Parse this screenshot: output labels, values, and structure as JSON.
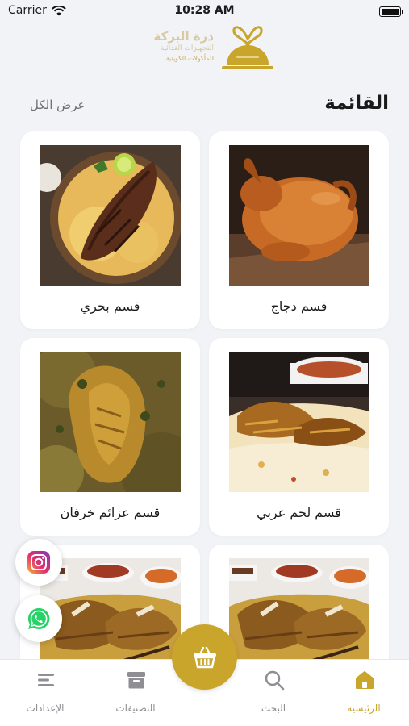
{
  "status_bar": {
    "carrier": "Carrier",
    "time": "10:28 AM"
  },
  "logo": {
    "line1": "درة البركة",
    "line2": "التجهيزات الغذائية",
    "line3": "للمأكولات الكويتية"
  },
  "header": {
    "title": "القائمة",
    "view_all": "عرض الكل"
  },
  "categories": [
    {
      "label": "قسم دجاج",
      "image": "roast-chicken"
    },
    {
      "label": "قسم بحري",
      "image": "fish-rice"
    },
    {
      "label": "قسم لحم عربي",
      "image": "meat-rice"
    },
    {
      "label": "قسم عزائم خرفان",
      "image": "lamb-rice"
    },
    {
      "label": "",
      "image": "lamb-platter"
    },
    {
      "label": "",
      "image": "lamb-platter"
    }
  ],
  "social": {
    "instagram": "instagram-icon",
    "whatsapp": "whatsapp-icon"
  },
  "tabbar": {
    "home": "الرئيسية",
    "search": "البحث",
    "categories": "التصنيفات",
    "settings": "الإعدادات"
  },
  "colors": {
    "accent": "#c9a52b",
    "background": "#f2f3f6",
    "inactive": "#8e8e93"
  }
}
